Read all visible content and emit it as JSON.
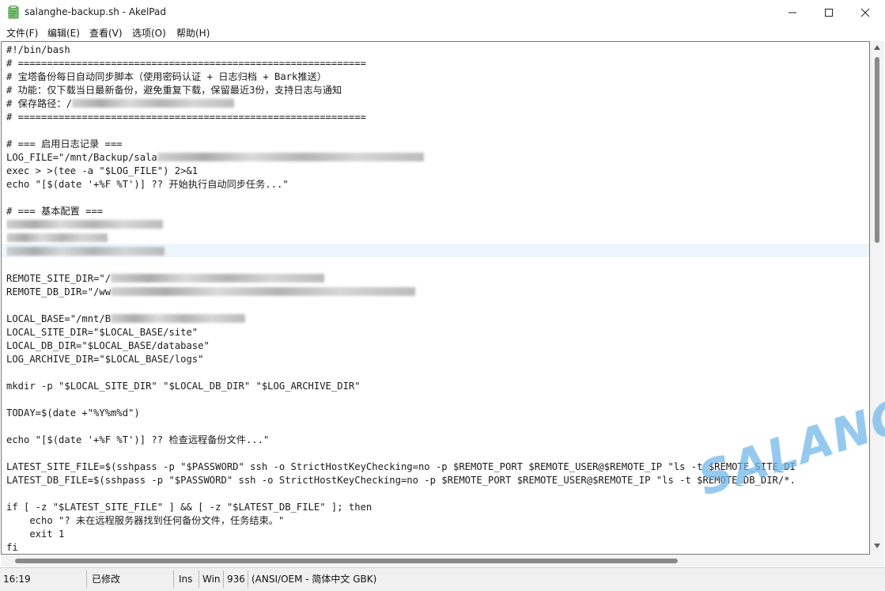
{
  "window": {
    "title": "salanghe-backup.sh - AkelPad"
  },
  "menu": {
    "items": [
      "文件(F)",
      "编辑(E)",
      "查看(V)",
      "选项(O)",
      "帮助(H)"
    ]
  },
  "editor": {
    "lines": [
      "#!/bin/bash",
      "# ============================================================",
      "# 宝塔备份每日自动同步脚本（使用密码认证 + 日志归档 + Bark推送）",
      "# 功能：仅下载当日最新备份，避免重复下载，保留最近3份，支持日志与通知",
      "# 保存路径：/",
      "# ============================================================",
      "",
      "# === 启用日志记录 ===",
      "LOG_FILE=\"/mnt/Backup/sala",
      "exec > >(tee -a \"$LOG_FILE\") 2>&1",
      "echo \"[$(date '+%F %T')] ?? 开始执行自动同步任务...\"",
      "",
      "# === 基本配置 ===",
      "",
      "",
      "",
      "",
      "REMOTE_SITE_DIR=\"/",
      "REMOTE_DB_DIR=\"/ww",
      "",
      "LOCAL_BASE=\"/mnt/B",
      "LOCAL_SITE_DIR=\"$LOCAL_BASE/site\"",
      "LOCAL_DB_DIR=\"$LOCAL_BASE/database\"",
      "LOG_ARCHIVE_DIR=\"$LOCAL_BASE/logs\"",
      "",
      "mkdir -p \"$LOCAL_SITE_DIR\" \"$LOCAL_DB_DIR\" \"$LOG_ARCHIVE_DIR\"",
      "",
      "TODAY=$(date +\"%Y%m%d\")",
      "",
      "echo \"[$(date '+%F %T')] ?? 检查远程备份文件...\"",
      "",
      "LATEST_SITE_FILE=$(sshpass -p \"$PASSWORD\" ssh -o StrictHostKeyChecking=no -p $REMOTE_PORT $REMOTE_USER@$REMOTE_IP \"ls -t $REMOTE_SITE_DI",
      "LATEST_DB_FILE=$(sshpass -p \"$PASSWORD\" ssh -o StrictHostKeyChecking=no -p $REMOTE_PORT $REMOTE_USER@$REMOTE_IP \"ls -t $REMOTE_DB_DIR/*.",
      "",
      "if [ -z \"$LATEST_SITE_FILE\" ] && [ -z \"$LATEST_DB_FILE\" ]; then",
      "    echo \"? 未在远程服务器找到任何备份文件，任务结束。\"",
      "    exit 1",
      "fi"
    ]
  },
  "status": {
    "position": "16:19",
    "modified": "已修改",
    "insert_mode": "Ins",
    "newline": "Win",
    "codepage_num": "936",
    "codepage_name": "(ANSI/OEM - 简体中文 GBK)"
  },
  "watermark": {
    "text": "SALANGHE"
  }
}
